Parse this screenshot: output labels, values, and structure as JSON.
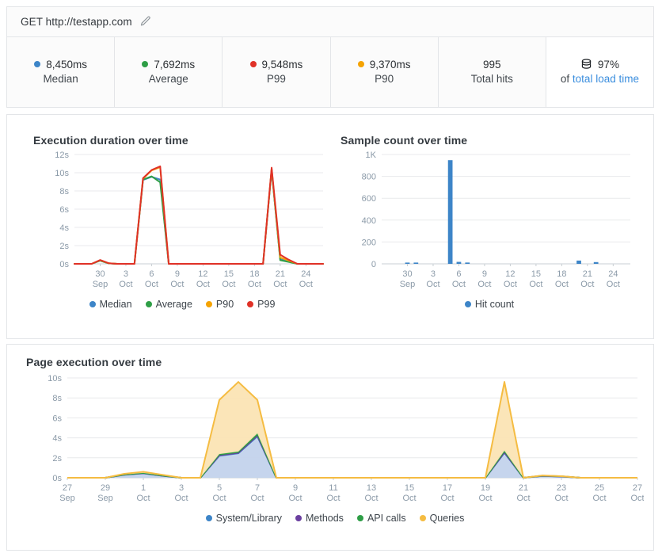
{
  "header": {
    "url_label": "GET http://testapp.com",
    "edit_icon": "pencil-icon"
  },
  "stats": [
    {
      "value": "8,450ms",
      "label": "Median",
      "color": "#3d85c8",
      "has_dot": true
    },
    {
      "value": "7,692ms",
      "label": "Average",
      "color": "#2e9e46",
      "has_dot": true
    },
    {
      "value": "9,548ms",
      "label": "P99",
      "color": "#e03127",
      "has_dot": true
    },
    {
      "value": "9,370ms",
      "label": "P90",
      "color": "#f5a302",
      "has_dot": true
    },
    {
      "value": "995",
      "label": "Total hits",
      "color": "",
      "has_dot": false
    }
  ],
  "load_stat": {
    "icon": "database-icon",
    "value": "97%",
    "prefix": "of ",
    "link_text": "total load time"
  },
  "chart_data": [
    {
      "id": "chart1",
      "type": "line",
      "title": "Execution duration over time",
      "xlabel": "",
      "ylabel": "",
      "ylim": [
        0,
        12
      ],
      "ytick_labels": [
        "0s",
        "2s",
        "4s",
        "6s",
        "8s",
        "10s",
        "12s"
      ],
      "ytick_values": [
        0,
        2,
        4,
        6,
        8,
        10,
        12
      ],
      "grid": true,
      "legend_position": "bottom",
      "x": [
        27,
        28,
        29,
        30,
        1,
        2,
        3,
        4,
        5,
        6,
        7,
        8,
        9,
        10,
        11,
        12,
        13,
        14,
        15,
        16,
        17,
        18,
        19,
        20,
        21,
        22,
        23,
        24,
        25,
        26
      ],
      "xtick_labels": [
        {
          "day": "30",
          "month": "Sep",
          "index": 3
        },
        {
          "day": "3",
          "month": "Oct",
          "index": 6
        },
        {
          "day": "6",
          "month": "Oct",
          "index": 9
        },
        {
          "day": "9",
          "month": "Oct",
          "index": 12
        },
        {
          "day": "12",
          "month": "Oct",
          "index": 15
        },
        {
          "day": "15",
          "month": "Oct",
          "index": 18
        },
        {
          "day": "18",
          "month": "Oct",
          "index": 21
        },
        {
          "day": "21",
          "month": "Oct",
          "index": 24
        },
        {
          "day": "24",
          "month": "Oct",
          "index": 27
        }
      ],
      "series": [
        {
          "name": "Median",
          "color": "#3d85c8",
          "values": [
            0,
            0,
            0,
            0.35,
            0.05,
            0,
            0,
            0,
            9.2,
            9.55,
            9.25,
            0,
            0,
            0,
            0,
            0,
            0,
            0,
            0,
            0,
            0,
            0,
            0,
            10.3,
            0.5,
            0.25,
            0,
            0,
            0,
            0
          ]
        },
        {
          "name": "Average",
          "color": "#2e9e46",
          "values": [
            0,
            0,
            0,
            0.35,
            0.05,
            0,
            0,
            0,
            9.25,
            9.6,
            8.95,
            0,
            0,
            0,
            0,
            0,
            0,
            0,
            0,
            0,
            0,
            0,
            0,
            10.35,
            0.4,
            0.2,
            0,
            0,
            0,
            0
          ]
        },
        {
          "name": "P90",
          "color": "#f5a302",
          "values": [
            0,
            0,
            0,
            0.4,
            0.06,
            0,
            0,
            0,
            9.35,
            10.25,
            10.6,
            0,
            0,
            0,
            0,
            0,
            0,
            0,
            0,
            0,
            0,
            0,
            0,
            10.45,
            0.7,
            0.35,
            0,
            0,
            0,
            0
          ]
        },
        {
          "name": "P99",
          "color": "#e03127",
          "values": [
            0,
            0,
            0,
            0.42,
            0.07,
            0,
            0,
            0,
            9.4,
            10.3,
            10.7,
            0,
            0,
            0,
            0,
            0,
            0,
            0,
            0,
            0,
            0,
            0,
            0,
            10.55,
            1.0,
            0.45,
            0,
            0,
            0,
            0
          ]
        }
      ]
    },
    {
      "id": "chart2",
      "type": "bar",
      "title": "Sample count over time",
      "xlabel": "",
      "ylabel": "",
      "ylim": [
        0,
        1000
      ],
      "ytick_labels": [
        "0",
        "200",
        "400",
        "600",
        "800",
        "1K"
      ],
      "ytick_values": [
        0,
        200,
        400,
        600,
        800,
        1000
      ],
      "grid": true,
      "legend_position": "bottom",
      "categories": [
        27,
        28,
        29,
        30,
        1,
        2,
        3,
        4,
        5,
        6,
        7,
        8,
        9,
        10,
        11,
        12,
        13,
        14,
        15,
        16,
        17,
        18,
        19,
        20,
        21,
        22,
        23,
        24,
        25,
        26
      ],
      "xtick_labels": [
        {
          "day": "30",
          "month": "Sep",
          "index": 3
        },
        {
          "day": "3",
          "month": "Oct",
          "index": 6
        },
        {
          "day": "6",
          "month": "Oct",
          "index": 9
        },
        {
          "day": "9",
          "month": "Oct",
          "index": 12
        },
        {
          "day": "12",
          "month": "Oct",
          "index": 15
        },
        {
          "day": "15",
          "month": "Oct",
          "index": 18
        },
        {
          "day": "18",
          "month": "Oct",
          "index": 21
        },
        {
          "day": "21",
          "month": "Oct",
          "index": 24
        },
        {
          "day": "24",
          "month": "Oct",
          "index": 27
        }
      ],
      "series": [
        {
          "name": "Hit count",
          "color": "#3d85c8",
          "values": [
            0,
            0,
            0,
            6,
            4,
            0,
            0,
            0,
            948,
            18,
            12,
            0,
            0,
            0,
            0,
            0,
            0,
            0,
            0,
            0,
            0,
            0,
            0,
            30,
            0,
            16,
            0,
            0,
            0,
            0
          ]
        }
      ]
    },
    {
      "id": "chart3",
      "type": "area",
      "title": "Page execution over time",
      "xlabel": "",
      "ylabel": "",
      "ylim": [
        0,
        10
      ],
      "ytick_labels": [
        "0s",
        "2s",
        "4s",
        "6s",
        "8s",
        "10s"
      ],
      "ytick_values": [
        0,
        2,
        4,
        6,
        8,
        10
      ],
      "grid": true,
      "stacked": true,
      "legend_position": "bottom",
      "x": [
        27,
        28,
        29,
        30,
        1,
        2,
        3,
        4,
        5,
        6,
        7,
        8,
        9,
        10,
        11,
        12,
        13,
        14,
        15,
        16,
        17,
        18,
        19,
        20,
        21,
        22,
        23,
        24,
        25,
        26,
        27
      ],
      "xtick_labels": [
        {
          "day": "27",
          "month": "Sep",
          "index": 0
        },
        {
          "day": "29",
          "month": "Sep",
          "index": 2
        },
        {
          "day": "1",
          "month": "Oct",
          "index": 4
        },
        {
          "day": "3",
          "month": "Oct",
          "index": 6
        },
        {
          "day": "5",
          "month": "Oct",
          "index": 8
        },
        {
          "day": "7",
          "month": "Oct",
          "index": 10
        },
        {
          "day": "9",
          "month": "Oct",
          "index": 12
        },
        {
          "day": "11",
          "month": "Oct",
          "index": 14
        },
        {
          "day": "13",
          "month": "Oct",
          "index": 16
        },
        {
          "day": "15",
          "month": "Oct",
          "index": 18
        },
        {
          "day": "17",
          "month": "Oct",
          "index": 20
        },
        {
          "day": "19",
          "month": "Oct",
          "index": 22
        },
        {
          "day": "21",
          "month": "Oct",
          "index": 24
        },
        {
          "day": "23",
          "month": "Oct",
          "index": 26
        },
        {
          "day": "25",
          "month": "Oct",
          "index": 28
        },
        {
          "day": "27",
          "month": "Oct",
          "index": 30
        }
      ],
      "series": [
        {
          "name": "System/Library",
          "color": "#3d85c8",
          "fill": "#c3d3ec",
          "values": [
            0,
            0,
            0,
            0.3,
            0.45,
            0.2,
            0,
            0,
            2.2,
            2.45,
            4.15,
            0,
            0,
            0,
            0,
            0,
            0,
            0,
            0,
            0,
            0,
            0,
            0,
            2.5,
            0,
            0.18,
            0.12,
            0,
            0,
            0,
            0
          ]
        },
        {
          "name": "Methods",
          "color": "#6b3fa0",
          "fill": "#6b3fa0",
          "values": [
            0,
            0,
            0,
            0.01,
            0.01,
            0.01,
            0,
            0,
            0.05,
            0.05,
            0.08,
            0,
            0,
            0,
            0,
            0,
            0,
            0,
            0,
            0,
            0,
            0,
            0,
            0.05,
            0,
            0.01,
            0.01,
            0,
            0,
            0,
            0
          ]
        },
        {
          "name": "API calls",
          "color": "#2e9e46",
          "fill": "#2e9e46",
          "values": [
            0,
            0,
            0,
            0.02,
            0.03,
            0.02,
            0,
            0,
            0.12,
            0.12,
            0.2,
            0,
            0,
            0,
            0,
            0,
            0,
            0,
            0,
            0,
            0,
            0,
            0,
            0.15,
            0,
            0.02,
            0.02,
            0,
            0,
            0,
            0
          ]
        },
        {
          "name": "Queries",
          "color": "#f5bc42",
          "fill": "#fbe4b4",
          "values": [
            0,
            0,
            0,
            0.07,
            0.11,
            0.07,
            0,
            0,
            5.43,
            6.98,
            3.37,
            0,
            0,
            0,
            0,
            0,
            0,
            0,
            0,
            0,
            0,
            0,
            0,
            6.9,
            0,
            0.02,
            0.01,
            0,
            0,
            0,
            0
          ]
        }
      ]
    }
  ]
}
